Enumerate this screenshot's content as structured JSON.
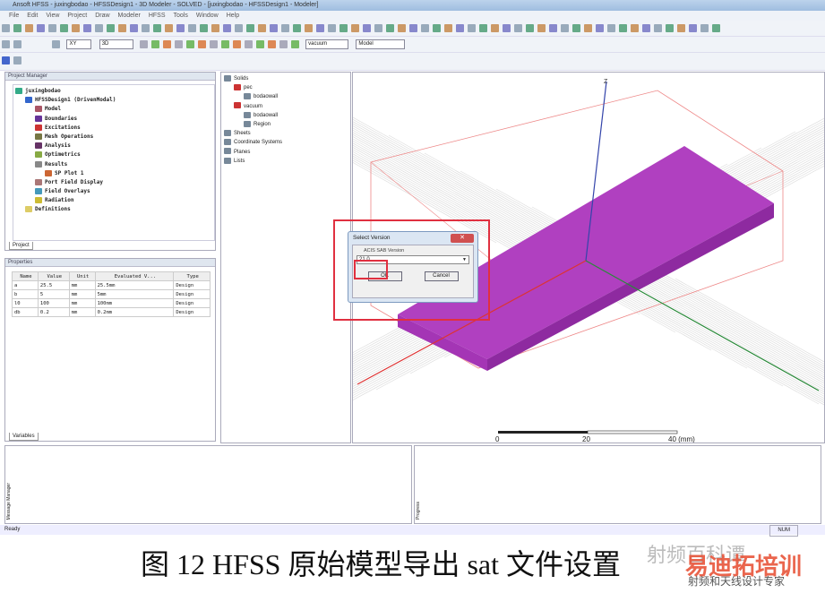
{
  "window": {
    "title": "Ansoft HFSS - juxingbodao - HFSSDesign1 - 3D Modeler - SOLVED - [juxingbodao - HFSSDesign1 - Modeler]"
  },
  "menu": [
    "File",
    "Edit",
    "View",
    "Project",
    "Draw",
    "Modeler",
    "HFSS",
    "Tools",
    "Window",
    "Help"
  ],
  "toolbar": {
    "plane_select": "XY",
    "dim_select": "3D",
    "material_select": "vacuum",
    "mode_select": "Model"
  },
  "project_manager": {
    "title": "Project Manager",
    "tab": "Project",
    "tree": [
      {
        "label": "juxingbodao",
        "level": 0,
        "color": "#3a8"
      },
      {
        "label": "HFSSDesign1 (DrivenModal)",
        "level": 1,
        "color": "#36c"
      },
      {
        "label": "Model",
        "level": 2,
        "color": "#a56"
      },
      {
        "label": "Boundaries",
        "level": 2,
        "color": "#639"
      },
      {
        "label": "Excitations",
        "level": 2,
        "color": "#c33"
      },
      {
        "label": "Mesh Operations",
        "level": 2,
        "color": "#774"
      },
      {
        "label": "Analysis",
        "level": 2,
        "color": "#636"
      },
      {
        "label": "Optimetrics",
        "level": 2,
        "color": "#8a4"
      },
      {
        "label": "Results",
        "level": 2,
        "color": "#888"
      },
      {
        "label": "SP Plot 1",
        "level": 3,
        "color": "#c63"
      },
      {
        "label": "Port Field Display",
        "level": 2,
        "color": "#a77"
      },
      {
        "label": "Field Overlays",
        "level": 2,
        "color": "#49b"
      },
      {
        "label": "Radiation",
        "level": 2,
        "color": "#cb3"
      },
      {
        "label": "Definitions",
        "level": 1,
        "color": "#dc6"
      }
    ]
  },
  "properties": {
    "title": "Properties",
    "tab": "Variables",
    "columns": [
      "Name",
      "Value",
      "Unit",
      "Evaluated V...",
      "Type"
    ],
    "rows": [
      [
        "a",
        "25.5",
        "mm",
        "25.5mm",
        "Design"
      ],
      [
        "b",
        "5",
        "mm",
        "5mm",
        "Design"
      ],
      [
        "l0",
        "100",
        "mm",
        "100mm",
        "Design"
      ],
      [
        "db",
        "0.2",
        "mm",
        "0.2mm",
        "Design"
      ]
    ]
  },
  "model_tree": [
    {
      "label": "Solids",
      "level": 0
    },
    {
      "label": "pec",
      "level": 1
    },
    {
      "label": "bodaowall",
      "level": 2
    },
    {
      "label": "vacuum",
      "level": 1
    },
    {
      "label": "bodaowall",
      "level": 2
    },
    {
      "label": "Region",
      "level": 2
    },
    {
      "label": "Sheets",
      "level": 0
    },
    {
      "label": "Coordinate Systems",
      "level": 0
    },
    {
      "label": "Planes",
      "level": 0
    },
    {
      "label": "Lists",
      "level": 0
    }
  ],
  "viewport": {
    "axis_label": "Z",
    "scale": [
      "0",
      "20",
      "40 (mm)"
    ],
    "slab_color": "#b040c0"
  },
  "dialog": {
    "title": "Select Version",
    "label": "ACIS SAB Version",
    "value": "21.0",
    "ok": "OK",
    "cancel": "Cancel",
    "highlight_color": "#e03040"
  },
  "bottom": {
    "message_manager": "Message Manager",
    "progress": "Progress"
  },
  "status": {
    "left": "Ready",
    "right": "NUM"
  },
  "caption": "图 12 HFSS 原始模型导出 sat 文件设置",
  "watermark": {
    "text": "射频百科谭",
    "logo": "易迪拓培训",
    "logo_sub": "射频和天线设计专家"
  }
}
